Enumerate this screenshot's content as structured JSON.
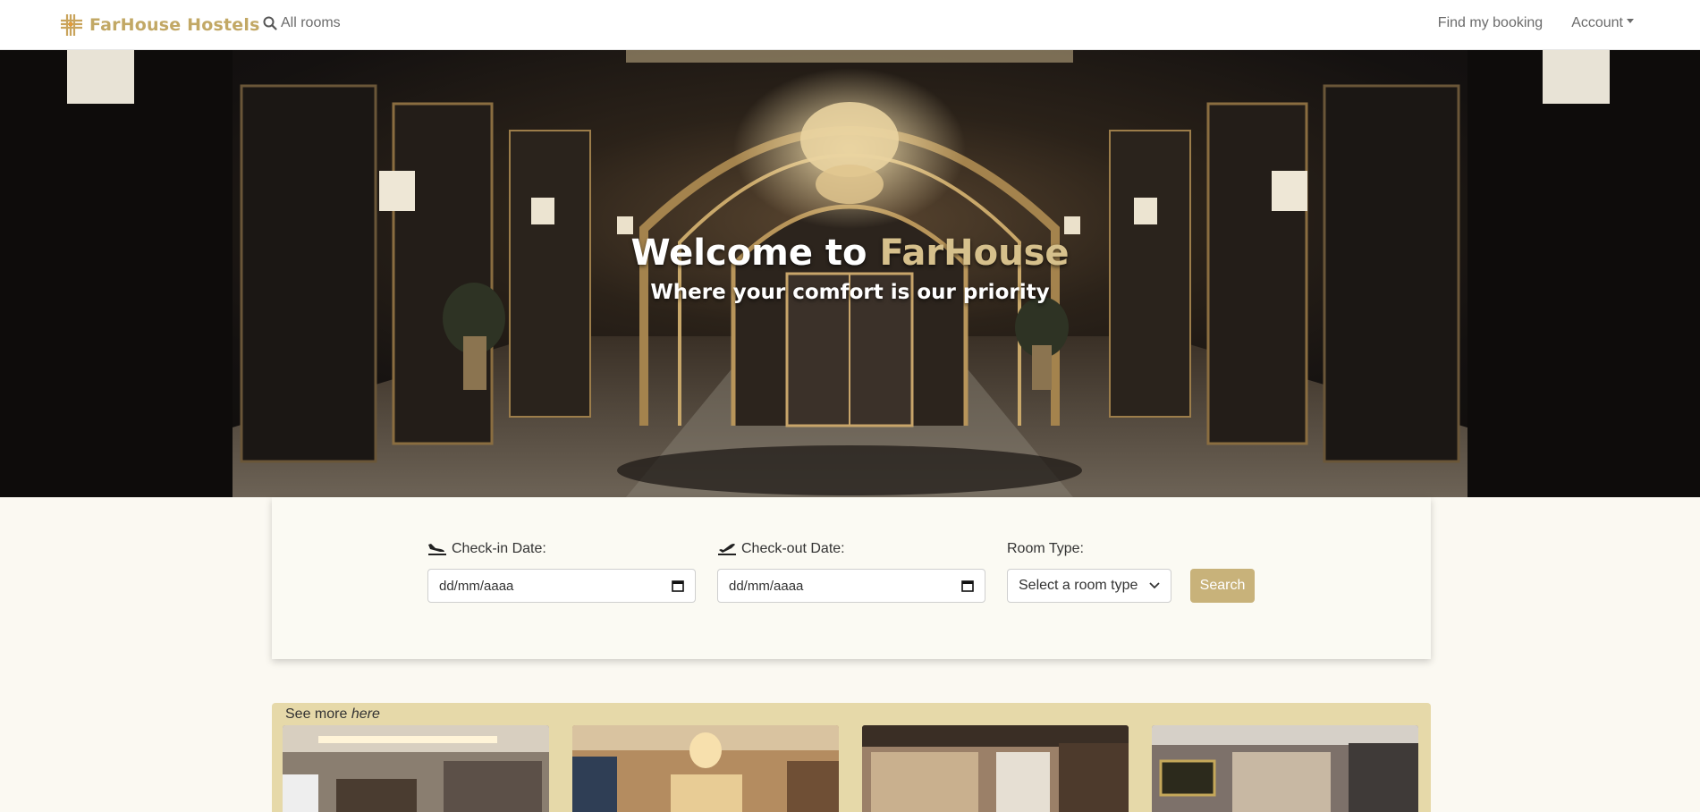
{
  "nav": {
    "brand": "FarHouse Hostels",
    "all_rooms": "All rooms",
    "find_booking": "Find my booking",
    "account": "Account",
    "search_icon": "search-icon",
    "logo_icon": "hash-grid-logo"
  },
  "hero": {
    "title_prefix": "Welcome to",
    "title_accent": "FarHouse",
    "subtitle": "Where your comfort is our priority"
  },
  "search": {
    "checkin_label": "Check-in Date:",
    "checkin_placeholder": "dd/mm/aaaa",
    "checkout_label": "Check-out Date:",
    "checkout_placeholder": "dd/mm/aaaa",
    "roomtype_label": "Room Type:",
    "roomtype_value": "Select a room type",
    "button": "Search"
  },
  "rooms": {
    "see_more_prefix": "See more",
    "see_more_link": "here",
    "cards": [
      "room-1",
      "room-2",
      "room-3",
      "room-4"
    ]
  },
  "colors": {
    "brand": "#c2a865",
    "accent": "#d6c08c",
    "button": "#c8b27a",
    "strip": "#e6d9a9",
    "page": "#fbf9f2"
  }
}
